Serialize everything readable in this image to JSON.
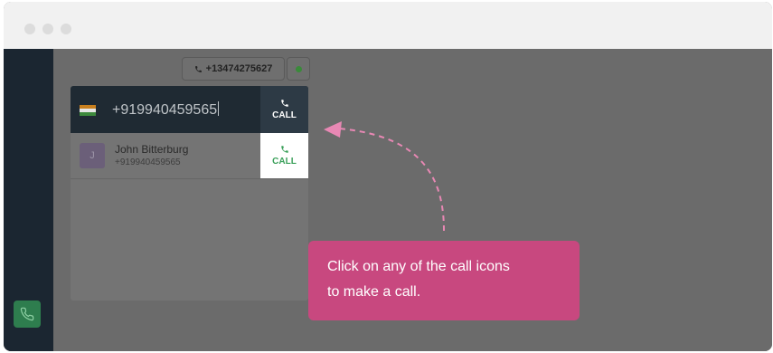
{
  "window": {
    "controls": [
      "close",
      "minimize",
      "maximize"
    ]
  },
  "sidebar": {
    "phone_button_icon": "phone-icon",
    "accent_color": "#2e7d4e"
  },
  "header": {
    "caller_number": "+13474275627",
    "status": "online",
    "status_color": "#3a8a3a"
  },
  "dialer": {
    "country_flag": "india-flag-icon",
    "input_value": "+919940459565",
    "call_label": "CALL"
  },
  "contacts": [
    {
      "initial": "J",
      "name": "John Bitterburg",
      "number": "+919940459565",
      "call_label": "CALL"
    }
  ],
  "tooltip": {
    "line1": "Click on any of the call icons",
    "line2": "to make a call.",
    "color": "#c8487f"
  }
}
